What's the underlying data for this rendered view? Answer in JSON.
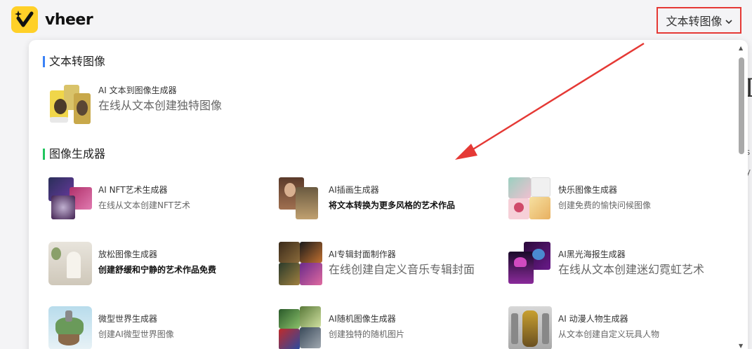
{
  "header": {
    "logo_text": "vheer",
    "nav_label": "文本转图像",
    "nav_icon": "chevron-down-icon"
  },
  "background": {
    "peek_big": "I",
    "peek_small_1": "s",
    "peek_small_2": "y"
  },
  "panel": {
    "sections": [
      {
        "title": "文本转图像",
        "accent": "#3b82f6",
        "items": [
          {
            "title": "AI 文本到图像生成器",
            "desc": "在线从文本创建独特图像"
          }
        ]
      },
      {
        "title": "图像生成器",
        "accent": "#22c55e",
        "items": [
          {
            "title": "AI NFT艺术生成器",
            "desc": "在线从文本创建NFT艺术"
          },
          {
            "title": "AI插画生成器",
            "desc": "将文本转换为更多风格的艺术作品"
          },
          {
            "title": "快乐图像生成器",
            "desc": "创建免费的愉快问候图像"
          },
          {
            "title": "放松图像生成器",
            "desc": "创建舒缓和宁静的艺术作品免费"
          },
          {
            "title": "AI专辑封面制作器",
            "desc": "在线创建自定义音乐专辑封面"
          },
          {
            "title": "AI黑光海报生成器",
            "desc": "在线从文本创建迷幻霓虹艺术"
          },
          {
            "title": "微型世界生成器",
            "desc": "创建AI微型世界图像"
          },
          {
            "title": "AI随机图像生成器",
            "desc": "创建独特的随机图片"
          },
          {
            "title": "AI 动漫人物生成器",
            "desc": "从文本创建自定义玩具人物"
          }
        ]
      }
    ]
  },
  "annotation": {
    "color": "#e53935"
  },
  "colors": {
    "brand": "#ffd028",
    "highlight": "#e53935"
  }
}
